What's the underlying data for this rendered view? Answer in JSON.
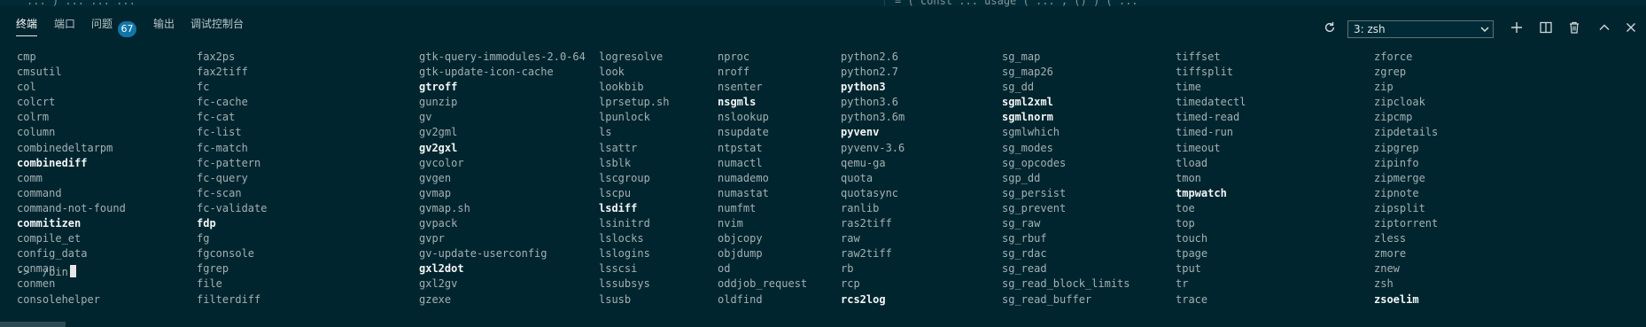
{
  "editor_peek": {
    "left_text": "... ) ...  ...  ...",
    "right_text": "= (  const  ...  usage  ( ...  , () )  ( ..."
  },
  "panel": {
    "tabs": [
      {
        "label": "终端"
      },
      {
        "label": "端口"
      },
      {
        "label": "问题"
      },
      {
        "label": "输出"
      },
      {
        "label": "调试控制台"
      }
    ],
    "problems_count": "67",
    "terminal_select": "3: zsh",
    "icons": {
      "refresh": "refresh-icon",
      "select_chevron": "chevron-down-icon",
      "new": "plus-icon",
      "split": "split-icon",
      "kill": "trash-icon",
      "maximize": "chevron-up-icon",
      "close": "close-icon"
    }
  },
  "terminal": {
    "columns": [
      {
        "entries": [
          {
            "text": "cmp",
            "bold": false
          },
          {
            "text": "cmsutil",
            "bold": false
          },
          {
            "text": "col",
            "bold": false
          },
          {
            "text": "colcrt",
            "bold": false
          },
          {
            "text": "colrm",
            "bold": false
          },
          {
            "text": "column",
            "bold": false
          },
          {
            "text": "combinedeltarpm",
            "bold": false
          },
          {
            "text": "combinediff",
            "bold": true
          },
          {
            "text": "comm",
            "bold": false
          },
          {
            "text": "command",
            "bold": false
          },
          {
            "text": "command-not-found",
            "bold": false
          },
          {
            "text": "commitizen",
            "bold": true
          },
          {
            "text": "compile_et",
            "bold": false
          },
          {
            "text": "config_data",
            "bold": false
          },
          {
            "text": "conman",
            "bold": false
          },
          {
            "text": "conmen",
            "bold": false
          },
          {
            "text": "consolehelper",
            "bold": false
          }
        ]
      },
      {
        "entries": [
          {
            "text": "fax2ps",
            "bold": false
          },
          {
            "text": "fax2tiff",
            "bold": false
          },
          {
            "text": "fc",
            "bold": false
          },
          {
            "text": "fc-cache",
            "bold": false
          },
          {
            "text": "fc-cat",
            "bold": false
          },
          {
            "text": "fc-list",
            "bold": false
          },
          {
            "text": "fc-match",
            "bold": false
          },
          {
            "text": "fc-pattern",
            "bold": false
          },
          {
            "text": "fc-query",
            "bold": false
          },
          {
            "text": "fc-scan",
            "bold": false
          },
          {
            "text": "fc-validate",
            "bold": false
          },
          {
            "text": "fdp",
            "bold": true
          },
          {
            "text": "fg",
            "bold": false
          },
          {
            "text": "fgconsole",
            "bold": false
          },
          {
            "text": "fgrep",
            "bold": false
          },
          {
            "text": "file",
            "bold": false
          },
          {
            "text": "filterdiff",
            "bold": false
          }
        ]
      },
      {
        "entries": [
          {
            "text": "gtk-query-immodules-2.0-64",
            "bold": false
          },
          {
            "text": "gtk-update-icon-cache",
            "bold": false
          },
          {
            "text": "gtroff",
            "bold": true
          },
          {
            "text": "gunzip",
            "bold": false
          },
          {
            "text": "gv",
            "bold": false
          },
          {
            "text": "gv2gml",
            "bold": false
          },
          {
            "text": "gv2gxl",
            "bold": true
          },
          {
            "text": "gvcolor",
            "bold": false
          },
          {
            "text": "gvgen",
            "bold": false
          },
          {
            "text": "gvmap",
            "bold": false
          },
          {
            "text": "gvmap.sh",
            "bold": false
          },
          {
            "text": "gvpack",
            "bold": false
          },
          {
            "text": "gvpr",
            "bold": false
          },
          {
            "text": "gv-update-userconfig",
            "bold": false
          },
          {
            "text": "gxl2dot",
            "bold": true
          },
          {
            "text": "gxl2gv",
            "bold": false
          },
          {
            "text": "gzexe",
            "bold": false
          }
        ]
      },
      {
        "entries": [
          {
            "text": "logresolve",
            "bold": false
          },
          {
            "text": "look",
            "bold": false
          },
          {
            "text": "lookbib",
            "bold": false
          },
          {
            "text": "lprsetup.sh",
            "bold": false
          },
          {
            "text": "lpunlock",
            "bold": false
          },
          {
            "text": "ls",
            "bold": false
          },
          {
            "text": "lsattr",
            "bold": false
          },
          {
            "text": "lsblk",
            "bold": false
          },
          {
            "text": "lscgroup",
            "bold": false
          },
          {
            "text": "lscpu",
            "bold": false
          },
          {
            "text": "lsdiff",
            "bold": true
          },
          {
            "text": "lsinitrd",
            "bold": false
          },
          {
            "text": "lslocks",
            "bold": false
          },
          {
            "text": "lslogins",
            "bold": false
          },
          {
            "text": "lsscsi",
            "bold": false
          },
          {
            "text": "lssubsys",
            "bold": false
          },
          {
            "text": "lsusb",
            "bold": false
          }
        ]
      },
      {
        "entries": [
          {
            "text": "nproc",
            "bold": false
          },
          {
            "text": "nroff",
            "bold": false
          },
          {
            "text": "nsenter",
            "bold": false
          },
          {
            "text": "nsgmls",
            "bold": true
          },
          {
            "text": "nslookup",
            "bold": false
          },
          {
            "text": "nsupdate",
            "bold": false
          },
          {
            "text": "ntpstat",
            "bold": false
          },
          {
            "text": "numactl",
            "bold": false
          },
          {
            "text": "numademo",
            "bold": false
          },
          {
            "text": "numastat",
            "bold": false
          },
          {
            "text": "numfmt",
            "bold": false
          },
          {
            "text": "nvim",
            "bold": false
          },
          {
            "text": "objcopy",
            "bold": false
          },
          {
            "text": "objdump",
            "bold": false
          },
          {
            "text": "od",
            "bold": false
          },
          {
            "text": "oddjob_request",
            "bold": false
          },
          {
            "text": "oldfind",
            "bold": false
          }
        ]
      },
      {
        "entries": [
          {
            "text": "python2.6",
            "bold": false
          },
          {
            "text": "python2.7",
            "bold": false
          },
          {
            "text": "python3",
            "bold": true
          },
          {
            "text": "python3.6",
            "bold": false
          },
          {
            "text": "python3.6m",
            "bold": false
          },
          {
            "text": "pyvenv",
            "bold": true
          },
          {
            "text": "pyvenv-3.6",
            "bold": false
          },
          {
            "text": "qemu-ga",
            "bold": false
          },
          {
            "text": "quota",
            "bold": false
          },
          {
            "text": "quotasync",
            "bold": false
          },
          {
            "text": "ranlib",
            "bold": false
          },
          {
            "text": "ras2tiff",
            "bold": false
          },
          {
            "text": "raw",
            "bold": false
          },
          {
            "text": "raw2tiff",
            "bold": false
          },
          {
            "text": "rb",
            "bold": false
          },
          {
            "text": "rcp",
            "bold": false
          },
          {
            "text": "rcs2log",
            "bold": true
          }
        ]
      },
      {
        "entries": [
          {
            "text": "sg_map",
            "bold": false
          },
          {
            "text": "sg_map26",
            "bold": false
          },
          {
            "text": "sg_dd",
            "bold": false
          },
          {
            "text": "sgml2xml",
            "bold": true
          },
          {
            "text": "sgmlnorm",
            "bold": true
          },
          {
            "text": "sgmlwhich",
            "bold": false
          },
          {
            "text": "sg_modes",
            "bold": false
          },
          {
            "text": "sg_opcodes",
            "bold": false
          },
          {
            "text": "sgp_dd",
            "bold": false
          },
          {
            "text": "sg_persist",
            "bold": false
          },
          {
            "text": "sg_prevent",
            "bold": false
          },
          {
            "text": "sg_raw",
            "bold": false
          },
          {
            "text": "sg_rbuf",
            "bold": false
          },
          {
            "text": "sg_rdac",
            "bold": false
          },
          {
            "text": "sg_read",
            "bold": false
          },
          {
            "text": "sg_read_block_limits",
            "bold": false
          },
          {
            "text": "sg_read_buffer",
            "bold": false
          }
        ]
      },
      {
        "entries": [
          {
            "text": "tiffset",
            "bold": false
          },
          {
            "text": "tiffsplit",
            "bold": false
          },
          {
            "text": "time",
            "bold": false
          },
          {
            "text": "timedatectl",
            "bold": false
          },
          {
            "text": "timed-read",
            "bold": false
          },
          {
            "text": "timed-run",
            "bold": false
          },
          {
            "text": "timeout",
            "bold": false
          },
          {
            "text": "tload",
            "bold": false
          },
          {
            "text": "tmon",
            "bold": false
          },
          {
            "text": "tmpwatch",
            "bold": true
          },
          {
            "text": "toe",
            "bold": false
          },
          {
            "text": "top",
            "bold": false
          },
          {
            "text": "touch",
            "bold": false
          },
          {
            "text": "tpage",
            "bold": false
          },
          {
            "text": "tput",
            "bold": false
          },
          {
            "text": "tr",
            "bold": false
          },
          {
            "text": "trace",
            "bold": false
          }
        ]
      },
      {
        "entries": [
          {
            "text": "zforce",
            "bold": false
          },
          {
            "text": "zgrep",
            "bold": false
          },
          {
            "text": "zip",
            "bold": false
          },
          {
            "text": "zipcloak",
            "bold": false
          },
          {
            "text": "zipcmp",
            "bold": false
          },
          {
            "text": "zipdetails",
            "bold": false
          },
          {
            "text": "zipgrep",
            "bold": false
          },
          {
            "text": "zipinfo",
            "bold": false
          },
          {
            "text": "zipmerge",
            "bold": false
          },
          {
            "text": "zipnote",
            "bold": false
          },
          {
            "text": "zipsplit",
            "bold": false
          },
          {
            "text": "ziptorrent",
            "bold": false
          },
          {
            "text": "zless",
            "bold": false
          },
          {
            "text": "zmore",
            "bold": false
          },
          {
            "text": "znew",
            "bold": false
          },
          {
            "text": "zsh",
            "bold": false
          },
          {
            "text": "zsoelim",
            "bold": true
          }
        ]
      }
    ],
    "prompt": {
      "arrow": "->",
      "cwd": "/bin"
    }
  }
}
